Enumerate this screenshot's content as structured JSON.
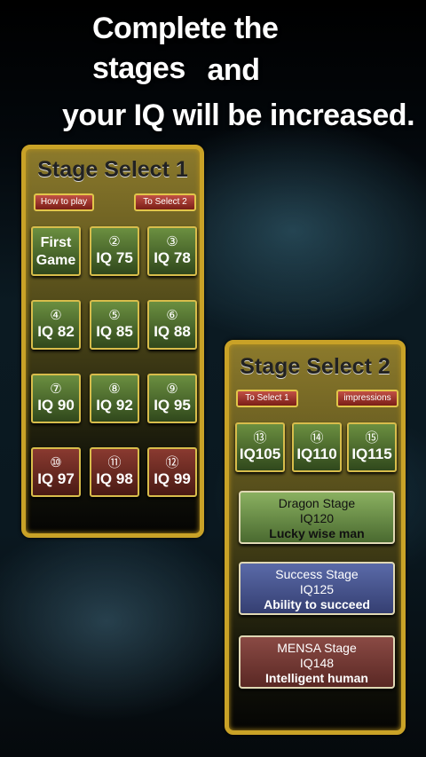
{
  "headline": {
    "line1": "Complete the stages",
    "line2": "and",
    "line3": "your IQ will be increased."
  },
  "stage_select_1": {
    "title": "Stage Select 1",
    "how_to_play": "How to play",
    "to_select_2": "To Select 2",
    "first": {
      "line1": "First",
      "line2": "Game"
    },
    "stages": [
      {
        "num": "②",
        "iq": "IQ 75",
        "color": "green"
      },
      {
        "num": "③",
        "iq": "IQ 78",
        "color": "green"
      },
      {
        "num": "④",
        "iq": "IQ 82",
        "color": "green"
      },
      {
        "num": "⑤",
        "iq": "IQ 85",
        "color": "green"
      },
      {
        "num": "⑥",
        "iq": "IQ 88",
        "color": "green"
      },
      {
        "num": "⑦",
        "iq": "IQ 90",
        "color": "green"
      },
      {
        "num": "⑧",
        "iq": "IQ 92",
        "color": "green"
      },
      {
        "num": "⑨",
        "iq": "IQ 95",
        "color": "green"
      },
      {
        "num": "⑩",
        "iq": "IQ 97",
        "color": "red"
      },
      {
        "num": "⑪",
        "iq": "IQ 98",
        "color": "red"
      },
      {
        "num": "⑫",
        "iq": "IQ 99",
        "color": "red"
      }
    ]
  },
  "stage_select_2": {
    "title": "Stage Select 2",
    "to_select_1": "To Select 1",
    "impressions": "impressions",
    "stages": [
      {
        "num": "⑬",
        "iq": "IQ105"
      },
      {
        "num": "⑭",
        "iq": "IQ110"
      },
      {
        "num": "⑮",
        "iq": "IQ115"
      }
    ],
    "special": [
      {
        "name": "Dragon Stage",
        "iq": "IQ120",
        "subtitle": "Lucky wise man",
        "color": "green"
      },
      {
        "name": "Success Stage",
        "iq": "IQ125",
        "subtitle": "Ability to succeed",
        "color": "blue"
      },
      {
        "name": "MENSA Stage",
        "iq": "IQ148",
        "subtitle": "Intelligent human",
        "color": "maroon"
      }
    ]
  }
}
